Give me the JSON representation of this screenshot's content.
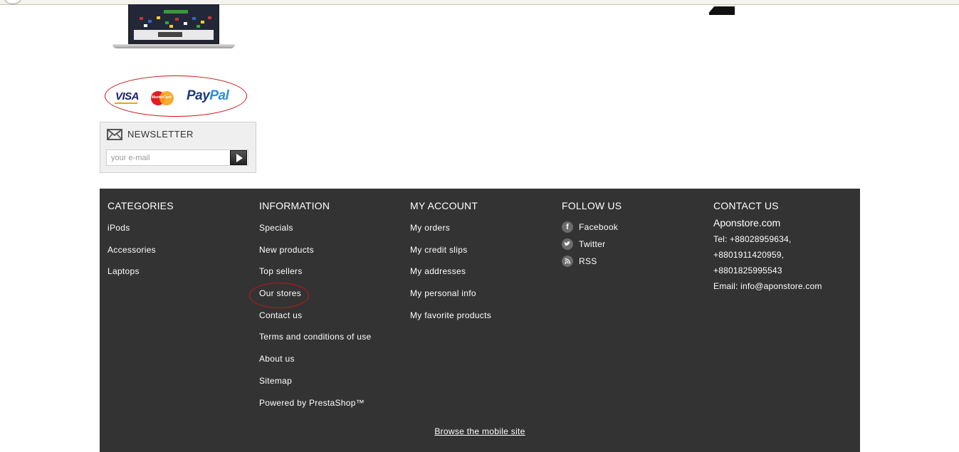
{
  "newsletter": {
    "title": "NEWSLETTER",
    "placeholder": "your e-mail"
  },
  "footer": {
    "categories": {
      "heading": "CATEGORIES",
      "items": [
        "iPods",
        "Accessories",
        "Laptops"
      ]
    },
    "information": {
      "heading": "INFORMATION",
      "items": [
        "Specials",
        "New products",
        "Top sellers",
        "Our stores",
        "Contact us",
        "Terms and conditions of use",
        "About us",
        "Sitemap",
        "Powered by PrestaShop™"
      ]
    },
    "account": {
      "heading": "MY ACCOUNT",
      "items": [
        "My orders",
        "My credit slips",
        "My addresses",
        "My personal info",
        "My favorite products"
      ]
    },
    "follow": {
      "heading": "FOLLOW US",
      "items": [
        {
          "label": "Facebook",
          "icon": "facebook-icon"
        },
        {
          "label": "Twitter",
          "icon": "twitter-icon"
        },
        {
          "label": "RSS",
          "icon": "rss-icon"
        }
      ]
    },
    "contact": {
      "heading": "CONTACT US",
      "site": "Aponstore.com",
      "lines": [
        "Tel: +88028959634,",
        "+8801911420959,",
        "+8801825995543",
        "Email: info@aponstore.com"
      ]
    },
    "mobile_link": "Browse the mobile site"
  },
  "colors": {
    "footer_bg": "#333333",
    "annotation_red": "#c81414"
  }
}
